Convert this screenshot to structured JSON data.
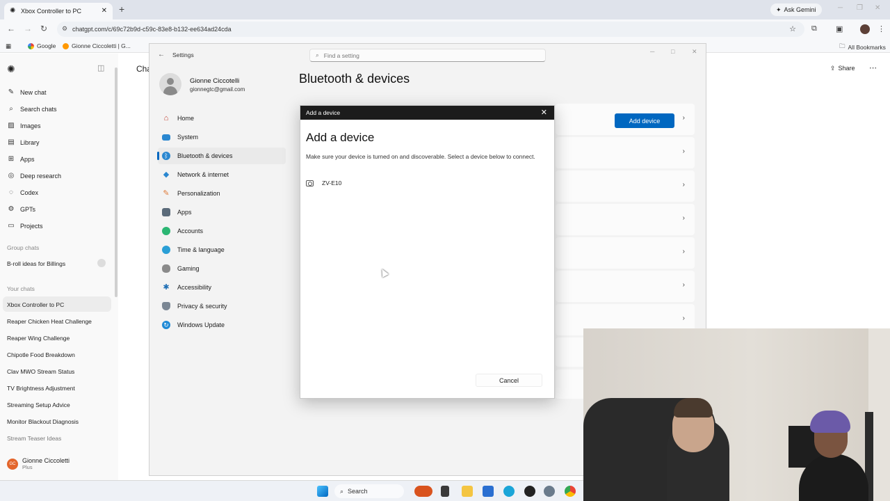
{
  "browser": {
    "tab_title": "Xbox Controller to PC",
    "url": "chatgpt.com/c/69c72b9d-c59c-83e8-b132-ee634ad24cda",
    "ask_gemini": "Ask Gemini",
    "bookmarks": [
      "Google",
      "Gionne Ciccoletti | G..."
    ],
    "all_bookmarks": "All Bookmarks"
  },
  "chatgpt": {
    "nav": [
      "New chat",
      "Search chats",
      "Images",
      "Library",
      "Apps",
      "Deep research",
      "Codex",
      "GPTs",
      "Projects"
    ],
    "group_chats_heading": "Group chats",
    "group_chats": [
      "B-roll ideas for Billings"
    ],
    "your_chats_heading": "Your chats",
    "chats": [
      "Xbox Controller to PC",
      "Reaper Chicken Heat Challenge",
      "Reaper Wing Challenge",
      "Chipotle Food Breakdown",
      "Clav MWO Stream Status",
      "TV Brightness Adjustment",
      "Streaming Setup Advice",
      "Monitor Blackout Diagnosis",
      "Stream Teaser Ideas"
    ],
    "user_name": "Gionne Ciccoletti",
    "user_plan": "Plus",
    "user_initials": "GC",
    "title_partial": "Cha",
    "share": "Share"
  },
  "settings": {
    "app_title": "Settings",
    "search_placeholder": "Find a setting",
    "profile_name": "Gionne Ciccotelli",
    "profile_email": "gionnegtc@gmail.com",
    "nav": [
      "Home",
      "System",
      "Bluetooth & devices",
      "Network & internet",
      "Personalization",
      "Apps",
      "Accounts",
      "Time & language",
      "Gaming",
      "Accessibility",
      "Privacy & security",
      "Windows Update"
    ],
    "active_nav": "Bluetooth & devices",
    "page_title": "Bluetooth & devices",
    "add_device_button": "Add device"
  },
  "dialog": {
    "titlebar": "Add a device",
    "heading": "Add a device",
    "description": "Make sure your device is turned on and discoverable. Select a device below to connect.",
    "device_name": "ZV-E10",
    "cancel": "Cancel"
  },
  "taskbar": {
    "search_label": "Search"
  },
  "colors": {
    "accent": "#0067c0",
    "dialog_titlebar": "#1c1c1c"
  }
}
